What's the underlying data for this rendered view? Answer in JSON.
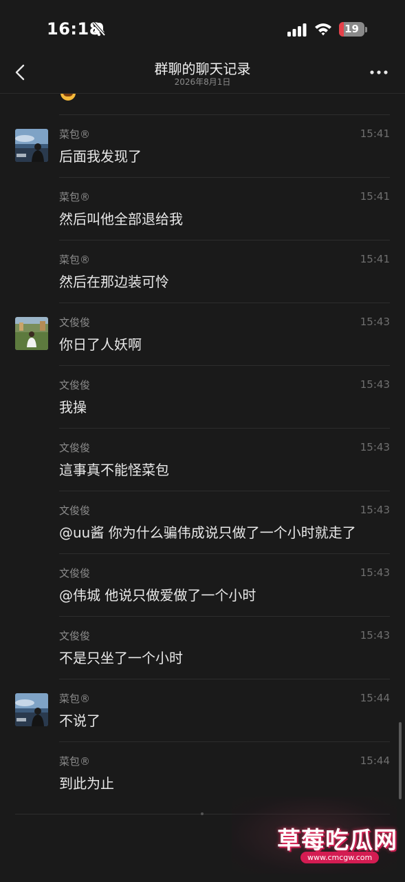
{
  "status_bar": {
    "time": "16:18",
    "battery_level": "19",
    "battery_fraction": 0.19,
    "icons": [
      "bell-slash-icon",
      "cellular-signal-icon",
      "wifi-icon",
      "battery-icon"
    ]
  },
  "nav": {
    "title": "群聊的聊天记录",
    "subtitle": "2026年8月1日",
    "back_icon": "chevron-left-icon",
    "more_icon": "ellipsis-icon"
  },
  "messages": [
    {
      "sender": "菜包®",
      "time": "15:41",
      "text": "后面我发现了",
      "avatar": "caibao"
    },
    {
      "sender": "菜包®",
      "time": "15:41",
      "text": "然后叫他全部退给我",
      "avatar": null
    },
    {
      "sender": "菜包®",
      "time": "15:41",
      "text": "然后在那边装可怜",
      "avatar": null
    },
    {
      "sender": "文俊俊",
      "time": "15:43",
      "text": "你日了人妖啊",
      "avatar": "wenjunjun"
    },
    {
      "sender": "文俊俊",
      "time": "15:43",
      "text": "我操",
      "avatar": null
    },
    {
      "sender": "文俊俊",
      "time": "15:43",
      "text": "這事真不能怪菜包",
      "avatar": null
    },
    {
      "sender": "文俊俊",
      "time": "15:43",
      "text": "@uu酱 你为什么骗伟成说只做了一个小时就走了",
      "avatar": null
    },
    {
      "sender": "文俊俊",
      "time": "15:43",
      "text": "@伟城 他说只做爱做了一个小时",
      "avatar": null
    },
    {
      "sender": "文俊俊",
      "time": "15:43",
      "text": "不是只坐了一个小时",
      "avatar": null
    },
    {
      "sender": "菜包®",
      "time": "15:44",
      "text": "不说了",
      "avatar": "caibao"
    },
    {
      "sender": "菜包®",
      "time": "15:44",
      "text": "到此为止",
      "avatar": null
    }
  ],
  "watermark": {
    "title": "草莓吃瓜网",
    "url": "www.cmcgw.com"
  },
  "colors": {
    "background": "#1a1a1a",
    "battery_low": "#e5414a",
    "watermark_accent": "#d41c52"
  }
}
